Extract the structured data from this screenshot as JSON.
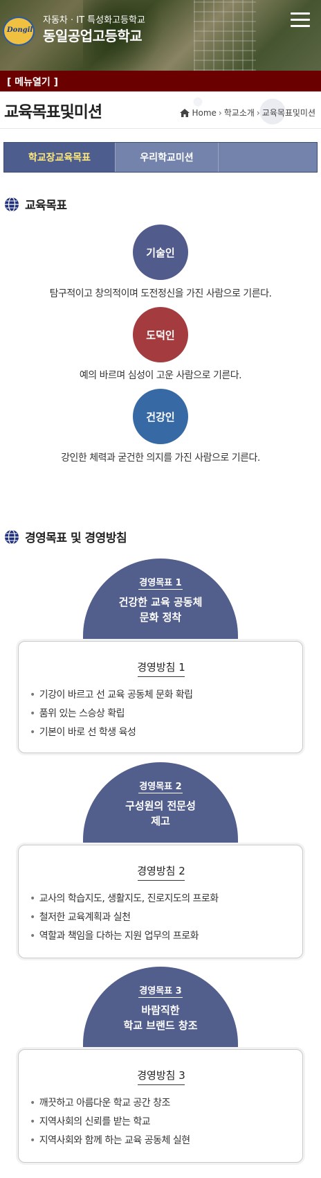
{
  "header": {
    "subtitle": "자동차 · IT 특성화고등학교",
    "school_name": "동일공업고등학교",
    "logo_text": "Dongil",
    "menu_icon": "hamburger-icon"
  },
  "menubar": {
    "label": "[ 메뉴열기 ]"
  },
  "page": {
    "title": "교육목표및미션",
    "breadcrumb": [
      "Home",
      "학교소개",
      "교육목표및미션"
    ]
  },
  "tabs": [
    {
      "label": "학교장교육목표",
      "active": true
    },
    {
      "label": "우리학교미션",
      "active": false
    },
    {
      "label": "",
      "active": false
    }
  ],
  "education": {
    "heading": "교육목표",
    "goals": [
      {
        "name": "기술인",
        "desc": "탐구적이고 창의적이며 도전정신을 가진 사람으로 기른다.",
        "color": "#515b8c"
      },
      {
        "name": "도덕인",
        "desc": "예의 바르며 심성이 고운 사람으로 기른다.",
        "color": "#a43b3e"
      },
      {
        "name": "건강인",
        "desc": "강인한 체력과 굳건한 의지를 가진 사람으로 기른다.",
        "color": "#3769a4"
      }
    ]
  },
  "management": {
    "heading": "경영목표 및 경영방침",
    "items": [
      {
        "goal_label": "경영목표 1",
        "goal_title_1": "건강한 교육 공동체",
        "goal_title_2": "문화 정착",
        "policy_label": "경영방침 1",
        "policies": [
          "기강이 바르고 선 교육 공동체 문화 확립",
          "품위 있는 스승상 확립",
          "기본이 바로 선 학생 육성"
        ]
      },
      {
        "goal_label": "경영목표 2",
        "goal_title_1": "구성원의 전문성",
        "goal_title_2": "제고",
        "policy_label": "경영방침 2",
        "policies": [
          "교사의 학습지도, 생활지도, 진로지도의 프로화",
          "철저한 교육계획과 실천",
          "역할과 책임을 다하는 지원 업무의 프로화"
        ]
      },
      {
        "goal_label": "경영목표 3",
        "goal_title_1": "바람직한",
        "goal_title_2": "학교 브랜드 창조",
        "policy_label": "경영방침 3",
        "policies": [
          "깨끗하고 아름다운 학교 공간 창조",
          "지역사회의 신뢰를 받는 학교",
          "지역사회와 함께 하는 교육 공동체 실현"
        ]
      }
    ]
  },
  "colors": {
    "menubar": "#6b0000",
    "tab_active": "#4d5e8e",
    "tab": "#7483ab",
    "dome": "#525e8c",
    "tab_active_text": "#ffe97a"
  }
}
